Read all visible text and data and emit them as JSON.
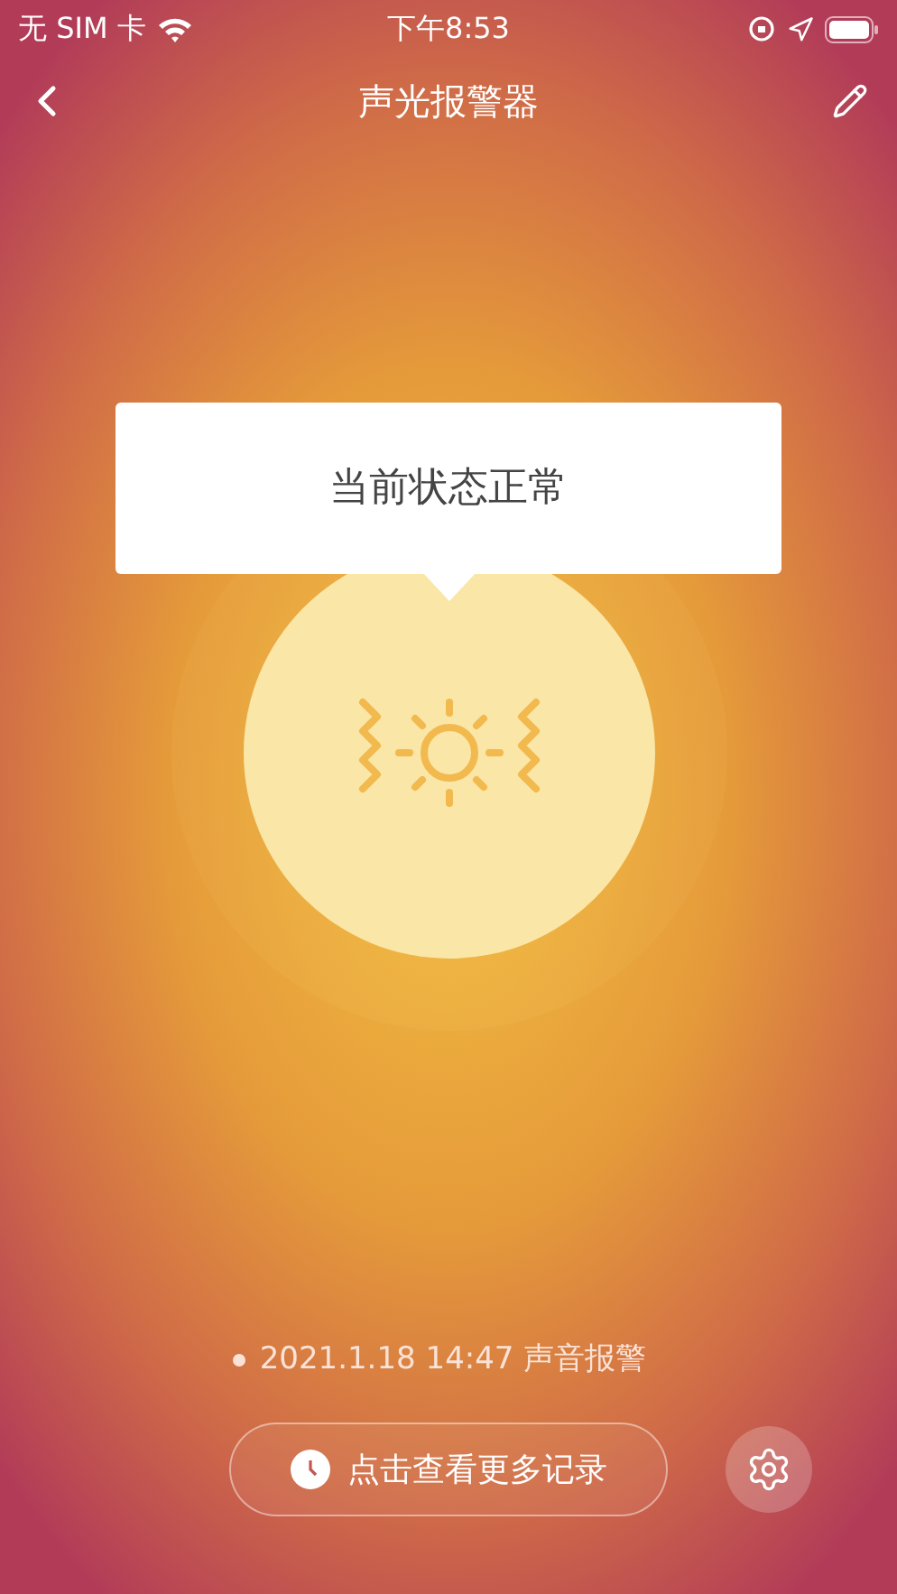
{
  "status_bar": {
    "carrier": "无 SIM 卡",
    "time": "下午8:53"
  },
  "nav_bar": {
    "title": "声光报警器"
  },
  "status_popup": {
    "text": "当前状态正常"
  },
  "last_record": {
    "text": "2021.1.18 14:47 声音报警"
  },
  "history_button": {
    "label": "点击查看更多记录"
  }
}
